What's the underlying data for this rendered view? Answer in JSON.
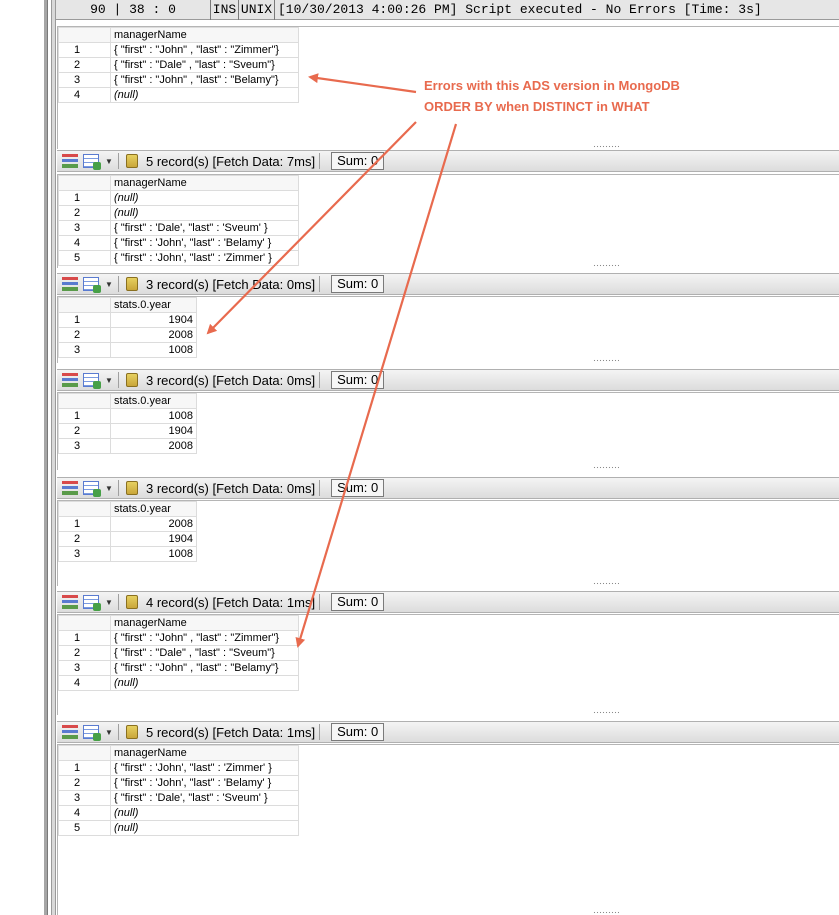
{
  "statusbar": {
    "position": "90 | 38 : 0",
    "mode": "INS",
    "line_ending": "UNIX",
    "message": "[10/30/2013 4:00:26 PM] Script executed - No Errors [Time: 3s]"
  },
  "annotation": {
    "line1": "Errors with this ADS version in MongoDB",
    "line2": "ORDER BY when DISTINCT in WHAT",
    "color": "#e86a4e"
  },
  "results": [
    {
      "toolbar": null,
      "column": "managerName",
      "rows": [
        {
          "n": "1",
          "v": "{ \"first\" : \"John\" , \"last\" : \"Zimmer\"}"
        },
        {
          "n": "2",
          "v": "{ \"first\" : \"Dale\" , \"last\" : \"Sveum\"}"
        },
        {
          "n": "3",
          "v": "{ \"first\" : \"John\" , \"last\" : \"Belamy\"}"
        },
        {
          "n": "4",
          "v": "(null)"
        }
      ]
    },
    {
      "toolbar": {
        "count": "5 record(s) [Fetch Data: 7ms]",
        "sum": "Sum: 0"
      },
      "column": "managerName",
      "rows": [
        {
          "n": "1",
          "v": "(null)"
        },
        {
          "n": "2",
          "v": "(null)"
        },
        {
          "n": "3",
          "v": "{ \"first\" : 'Dale', \"last\" : 'Sveum' }"
        },
        {
          "n": "4",
          "v": "{ \"first\" : 'John', \"last\" : 'Belamy' }"
        },
        {
          "n": "5",
          "v": "{ \"first\" : 'John', \"last\" : 'Zimmer' }"
        }
      ]
    },
    {
      "toolbar": {
        "count": "3 record(s) [Fetch Data: 0ms]",
        "sum": "Sum: 0"
      },
      "column": "stats.0.year",
      "rows": [
        {
          "n": "1",
          "v": "1904"
        },
        {
          "n": "2",
          "v": "2008"
        },
        {
          "n": "3",
          "v": "1008"
        }
      ]
    },
    {
      "toolbar": {
        "count": "3 record(s) [Fetch Data: 0ms]",
        "sum": "Sum: 0"
      },
      "column": "stats.0.year",
      "rows": [
        {
          "n": "1",
          "v": "1008"
        },
        {
          "n": "2",
          "v": "1904"
        },
        {
          "n": "3",
          "v": "2008"
        }
      ]
    },
    {
      "toolbar": {
        "count": "3 record(s) [Fetch Data: 0ms]",
        "sum": "Sum: 0"
      },
      "column": "stats.0.year",
      "rows": [
        {
          "n": "1",
          "v": "2008"
        },
        {
          "n": "2",
          "v": "1904"
        },
        {
          "n": "3",
          "v": "1008"
        }
      ]
    },
    {
      "toolbar": {
        "count": "4 record(s) [Fetch Data: 1ms]",
        "sum": "Sum: 0"
      },
      "column": "managerName",
      "rows": [
        {
          "n": "1",
          "v": "{ \"first\" : \"John\" , \"last\" : \"Zimmer\"}"
        },
        {
          "n": "2",
          "v": "{ \"first\" : \"Dale\" , \"last\" : \"Sveum\"}"
        },
        {
          "n": "3",
          "v": "{ \"first\" : \"John\" , \"last\" : \"Belamy\"}"
        },
        {
          "n": "4",
          "v": "(null)"
        }
      ]
    },
    {
      "toolbar": {
        "count": "5 record(s) [Fetch Data: 1ms]",
        "sum": "Sum: 0"
      },
      "column": "managerName",
      "rows": [
        {
          "n": "1",
          "v": "{ \"first\" : 'John', \"last\" : 'Zimmer' }"
        },
        {
          "n": "2",
          "v": "{ \"first\" : 'John', \"last\" : 'Belamy' }"
        },
        {
          "n": "3",
          "v": "{ \"first\" : 'Dale', \"last\" : 'Sveum' }"
        },
        {
          "n": "4",
          "v": "(null)"
        },
        {
          "n": "5",
          "v": "(null)"
        }
      ]
    }
  ]
}
